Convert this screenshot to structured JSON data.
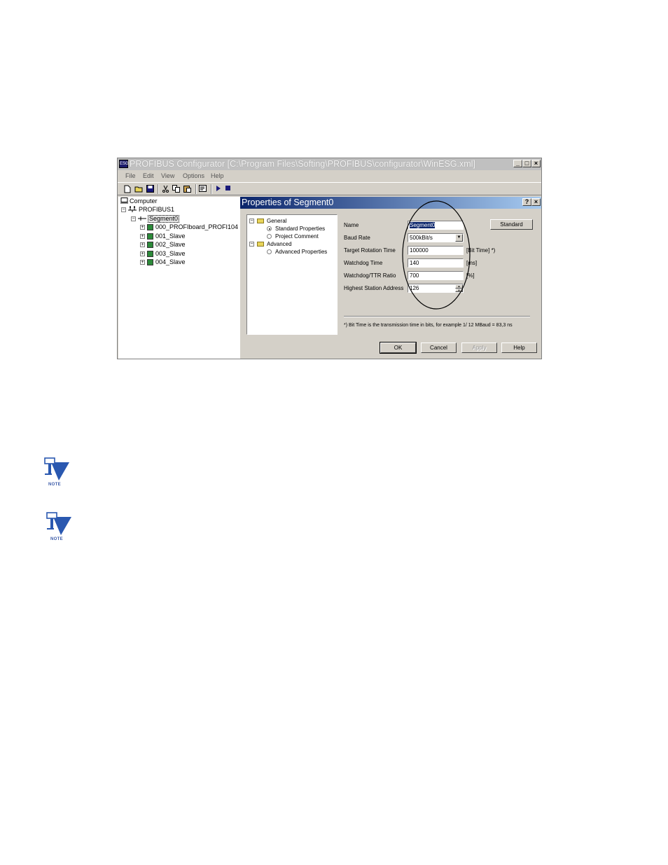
{
  "window": {
    "title": "PROFIBUS Configurator [C:\\Program Files\\Softing\\PROFIBUS\\configurator\\WinESG.xml]",
    "icon": "app-icon",
    "controls": [
      "_",
      "□",
      "×"
    ]
  },
  "menu": [
    "File",
    "Edit",
    "View",
    "Options",
    "Help"
  ],
  "toolbar": [
    "new-icon",
    "open-icon",
    "save-icon",
    "cut-icon",
    "copy-icon",
    "paste-icon",
    "properties-icon",
    "play-icon",
    "stop-icon"
  ],
  "tree": {
    "root": "Computer",
    "network": "PROFIBUS1",
    "segment": "Segment0",
    "slaves": [
      "000_PROFIboard_PROFI104",
      "001_Slave",
      "002_Slave",
      "003_Slave",
      "004_Slave"
    ]
  },
  "dialog": {
    "title": "Properties of Segment0",
    "help_btn": "?",
    "close_btn": "×",
    "nav": {
      "general": "General",
      "standard_properties": "Standard Properties",
      "project_comment": "Project Comment",
      "advanced": "Advanced",
      "advanced_properties": "Advanced Properties"
    },
    "fields": {
      "name_label": "Name",
      "name_value": "Segment0",
      "baud_label": "Baud Rate",
      "baud_value": "500kBit/s",
      "trt_label": "Target Rotation Time",
      "trt_value": "100000",
      "trt_unit": "[Bit Time] *)",
      "wd_label": "Watchdog Time",
      "wd_value": "140",
      "wd_unit": "[ms]",
      "ratio_label": "Watchdog/TTR Ratio",
      "ratio_value": "700",
      "ratio_unit": "[%]",
      "hsa_label": "Highest Station Address",
      "hsa_value": "126"
    },
    "standard_btn": "Standard",
    "footnote": "*) Bit Time is the transmission time in bits, for example 1/ 12 MBaud = 83,3 ns",
    "buttons": {
      "ok": "OK",
      "cancel": "Cancel",
      "apply": "Apply",
      "help": "Help"
    }
  },
  "notes": [
    "NOTE",
    "NOTE"
  ],
  "colors": {
    "dialog_title_start": "#0a246a",
    "dialog_title_end": "#a6caf0",
    "note_blue": "#2a58b0"
  }
}
